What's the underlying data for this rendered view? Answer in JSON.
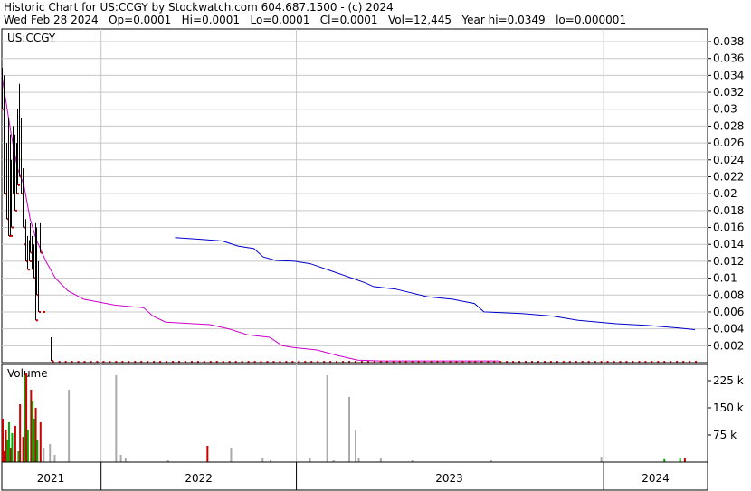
{
  "header": {
    "line1": "Historic Chart for US:CCGY by Stockwatch.com 604.687.1500 - (c) 2024",
    "line2": "Wed Feb 28 2024   Op=0.0001   Hi=0.0001   Lo=0.0001   Cl=0.0001   Vol=12,445   Year hi=0.0349   lo=0.000001"
  },
  "chart_data": [
    {
      "type": "line",
      "panel": "price",
      "title": "US:CCGY",
      "ylim": [
        0,
        0.0395
      ],
      "y_ticks": [
        "0.038",
        "0.036",
        "0.034",
        "0.032",
        "0.03",
        "0.028",
        "0.026",
        "0.024",
        "0.022",
        "0.02",
        "0.018",
        "0.016",
        "0.014",
        "0.012",
        "0.01",
        "0.008",
        "0.006",
        "0.004",
        "0.002"
      ],
      "x_labels": [
        "2021",
        "2022",
        "2023",
        "2024"
      ],
      "grid": true,
      "colors": {
        "price_bar": "#000000",
        "close_tick": "#cc0000",
        "ma_short": "#cc00cc",
        "ma_long": "#0000cc",
        "grid": "#c8c8c8"
      },
      "price_bars": [
        {
          "t": 2021.0,
          "hi": 0.0349,
          "lo": 0.03
        },
        {
          "t": 2021.01,
          "hi": 0.034,
          "lo": 0.02
        },
        {
          "t": 2021.02,
          "hi": 0.032,
          "lo": 0.02
        },
        {
          "t": 2021.03,
          "hi": 0.026,
          "lo": 0.017
        },
        {
          "t": 2021.04,
          "hi": 0.029,
          "lo": 0.015
        },
        {
          "t": 2021.05,
          "hi": 0.027,
          "lo": 0.015
        },
        {
          "t": 2021.06,
          "hi": 0.024,
          "lo": 0.016
        },
        {
          "t": 2021.07,
          "hi": 0.028,
          "lo": 0.02
        },
        {
          "t": 2021.08,
          "hi": 0.027,
          "lo": 0.018
        },
        {
          "t": 2021.09,
          "hi": 0.026,
          "lo": 0.02
        },
        {
          "t": 2021.1,
          "hi": 0.03,
          "lo": 0.021
        },
        {
          "t": 2021.11,
          "hi": 0.033,
          "lo": 0.022
        },
        {
          "t": 2021.12,
          "hi": 0.029,
          "lo": 0.02
        },
        {
          "t": 2021.13,
          "hi": 0.023,
          "lo": 0.016
        },
        {
          "t": 2021.14,
          "hi": 0.019,
          "lo": 0.014
        },
        {
          "t": 2021.15,
          "hi": 0.017,
          "lo": 0.012
        },
        {
          "t": 2021.16,
          "hi": 0.015,
          "lo": 0.011
        },
        {
          "t": 2021.17,
          "hi": 0.0145,
          "lo": 0.012
        },
        {
          "t": 2021.18,
          "hi": 0.0165,
          "lo": 0.013
        },
        {
          "t": 2021.19,
          "hi": 0.015,
          "lo": 0.011
        },
        {
          "t": 2021.2,
          "hi": 0.014,
          "lo": 0.01
        },
        {
          "t": 2021.21,
          "hi": 0.0165,
          "lo": 0.005
        },
        {
          "t": 2021.22,
          "hi": 0.016,
          "lo": 0.008
        },
        {
          "t": 2021.23,
          "hi": 0.012,
          "lo": 0.006
        },
        {
          "t": 2021.24,
          "hi": 0.0165,
          "lo": 0.013
        },
        {
          "t": 2021.26,
          "hi": 0.0075,
          "lo": 0.006
        },
        {
          "t": 2021.31,
          "hi": 0.003,
          "lo": 0.0002
        }
      ],
      "ma_short": [
        [
          2021.0,
          0.034
        ],
        [
          2021.06,
          0.027
        ],
        [
          2021.1,
          0.023
        ],
        [
          2021.14,
          0.021
        ],
        [
          2021.18,
          0.017
        ],
        [
          2021.22,
          0.0145
        ],
        [
          2021.28,
          0.012
        ],
        [
          2021.34,
          0.01
        ],
        [
          2021.42,
          0.0085
        ],
        [
          2021.52,
          0.0075
        ],
        [
          2021.72,
          0.0068
        ],
        [
          2021.9,
          0.0065
        ],
        [
          2021.96,
          0.0055
        ],
        [
          2022.04,
          0.0048
        ],
        [
          2022.32,
          0.0045
        ],
        [
          2022.44,
          0.004
        ],
        [
          2022.56,
          0.0033
        ],
        [
          2022.7,
          0.003
        ],
        [
          2022.78,
          0.002
        ],
        [
          2022.85,
          0.0018
        ],
        [
          2023.0,
          0.0015
        ],
        [
          2023.14,
          0.0008
        ],
        [
          2023.26,
          0.0003
        ],
        [
          2023.4,
          0.0002
        ],
        [
          2023.7,
          0.0002
        ],
        [
          2024.16,
          0.0002
        ]
      ],
      "ma_long": [
        [
          2022.1,
          0.0148
        ],
        [
          2022.26,
          0.0146
        ],
        [
          2022.4,
          0.0144
        ],
        [
          2022.5,
          0.0138
        ],
        [
          2022.6,
          0.0135
        ],
        [
          2022.66,
          0.0125
        ],
        [
          2022.74,
          0.0121
        ],
        [
          2022.86,
          0.012
        ],
        [
          2022.96,
          0.0117
        ],
        [
          2023.1,
          0.0108
        ],
        [
          2023.3,
          0.0095
        ],
        [
          2023.36,
          0.009
        ],
        [
          2023.5,
          0.0087
        ],
        [
          2023.7,
          0.0078
        ],
        [
          2023.86,
          0.0075
        ],
        [
          2024.0,
          0.007
        ],
        [
          2024.06,
          0.006
        ],
        [
          2024.3,
          0.0058
        ],
        [
          2024.5,
          0.0055
        ],
        [
          2024.66,
          0.005
        ],
        [
          2024.9,
          0.0046
        ],
        [
          2025.1,
          0.0044
        ],
        [
          2025.3,
          0.0041
        ],
        [
          2025.4,
          0.0039
        ]
      ]
    },
    {
      "type": "bar",
      "panel": "volume",
      "title": "Volume",
      "ylim": [
        0,
        270000
      ],
      "y_ticks": [
        "225 k",
        "150 k",
        "75 k"
      ],
      "colors": {
        "up": "#00aa00",
        "down": "#cc0000",
        "flat": "#aaaaaa"
      },
      "bars": [
        {
          "t": 2021.0,
          "v": 120000,
          "c": "down"
        },
        {
          "t": 2021.01,
          "v": 30000,
          "c": "down"
        },
        {
          "t": 2021.02,
          "v": 90000,
          "c": "down"
        },
        {
          "t": 2021.03,
          "v": 60000,
          "c": "up"
        },
        {
          "t": 2021.04,
          "v": 110000,
          "c": "up"
        },
        {
          "t": 2021.05,
          "v": 40000,
          "c": "down"
        },
        {
          "t": 2021.06,
          "v": 80000,
          "c": "up"
        },
        {
          "t": 2021.08,
          "v": 100000,
          "c": "down"
        },
        {
          "t": 2021.1,
          "v": 30000,
          "c": "up"
        },
        {
          "t": 2021.11,
          "v": 160000,
          "c": "down"
        },
        {
          "t": 2021.13,
          "v": 70000,
          "c": "down"
        },
        {
          "t": 2021.14,
          "v": 240000,
          "c": "up"
        },
        {
          "t": 2021.15,
          "v": 245000,
          "c": "down"
        },
        {
          "t": 2021.16,
          "v": 90000,
          "c": "up"
        },
        {
          "t": 2021.18,
          "v": 200000,
          "c": "down"
        },
        {
          "t": 2021.19,
          "v": 170000,
          "c": "up"
        },
        {
          "t": 2021.2,
          "v": 120000,
          "c": "up"
        },
        {
          "t": 2021.21,
          "v": 150000,
          "c": "down"
        },
        {
          "t": 2021.22,
          "v": 60000,
          "c": "up"
        },
        {
          "t": 2021.24,
          "v": 110000,
          "c": "down"
        },
        {
          "t": 2021.26,
          "v": 40000,
          "c": "flat"
        },
        {
          "t": 2021.3,
          "v": 50000,
          "c": "flat"
        },
        {
          "t": 2021.33,
          "v": 20000,
          "c": "flat"
        },
        {
          "t": 2021.42,
          "v": 200000,
          "c": "flat"
        },
        {
          "t": 2021.72,
          "v": 240000,
          "c": "flat"
        },
        {
          "t": 2021.75,
          "v": 20000,
          "c": "flat"
        },
        {
          "t": 2021.78,
          "v": 10000,
          "c": "flat"
        },
        {
          "t": 2022.05,
          "v": 5000,
          "c": "flat"
        },
        {
          "t": 2022.3,
          "v": 45000,
          "c": "down"
        },
        {
          "t": 2022.45,
          "v": 40000,
          "c": "flat"
        },
        {
          "t": 2022.65,
          "v": 10000,
          "c": "flat"
        },
        {
          "t": 2022.7,
          "v": 5000,
          "c": "flat"
        },
        {
          "t": 2022.95,
          "v": 10000,
          "c": "flat"
        },
        {
          "t": 2023.06,
          "v": 240000,
          "c": "flat"
        },
        {
          "t": 2023.1,
          "v": 5000,
          "c": "flat"
        },
        {
          "t": 2023.2,
          "v": 180000,
          "c": "flat"
        },
        {
          "t": 2023.24,
          "v": 90000,
          "c": "flat"
        },
        {
          "t": 2023.26,
          "v": 10000,
          "c": "flat"
        },
        {
          "t": 2023.4,
          "v": 10000,
          "c": "flat"
        },
        {
          "t": 2023.6,
          "v": 5000,
          "c": "flat"
        },
        {
          "t": 2024.1,
          "v": 5000,
          "c": "flat"
        },
        {
          "t": 2024.8,
          "v": 15000,
          "c": "flat"
        },
        {
          "t": 2025.2,
          "v": 8000,
          "c": "up"
        },
        {
          "t": 2025.3,
          "v": 12000,
          "c": "up"
        },
        {
          "t": 2025.33,
          "v": 10000,
          "c": "down"
        }
      ]
    }
  ]
}
